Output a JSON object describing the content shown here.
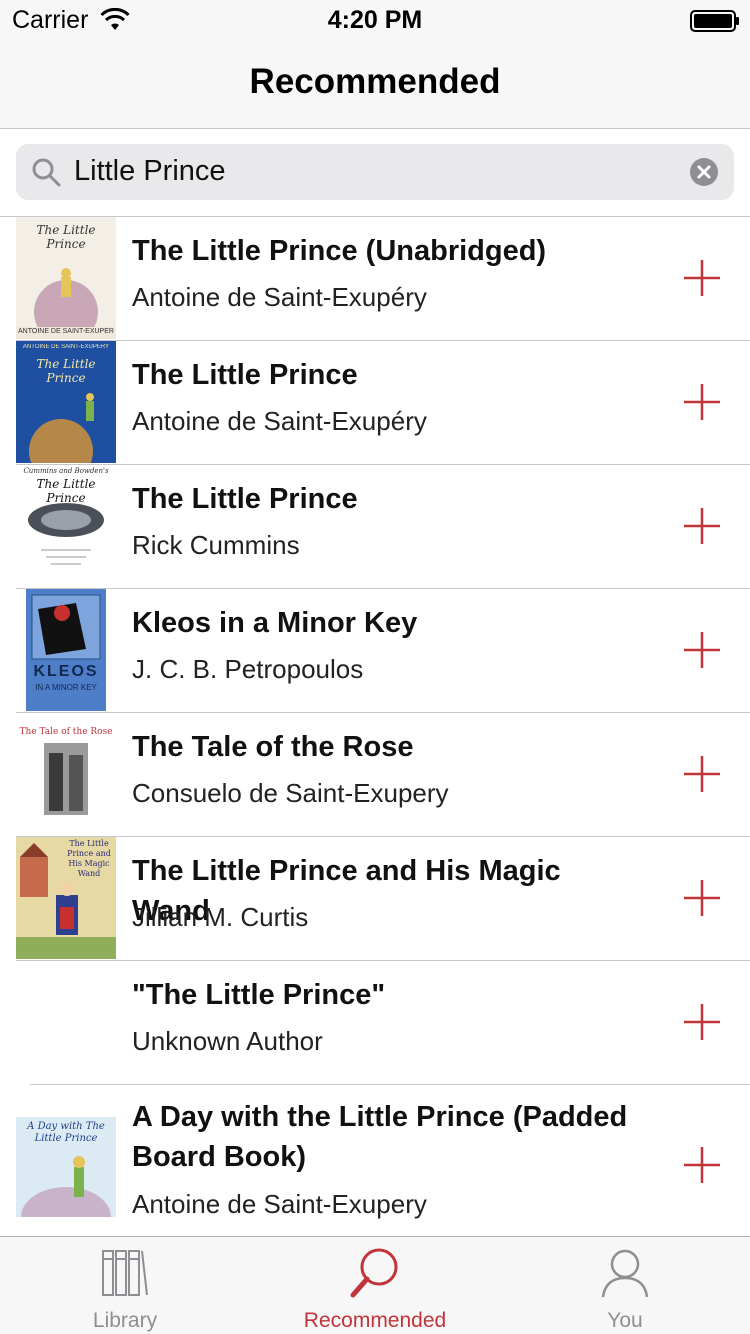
{
  "status_bar": {
    "carrier": "Carrier",
    "time": "4:20 PM"
  },
  "nav": {
    "title": "Recommended"
  },
  "search": {
    "value": "Little Prince"
  },
  "colors": {
    "accent": "#c0343a",
    "inactive": "#8e8e93",
    "separator": "#c8c7cc"
  },
  "books": [
    {
      "title": "The Little Prince (Unabridged)",
      "author": "Antoine de Saint-Exupéry",
      "cover_text": "The Little Prince",
      "cover_footer": "ANTOINE DE SAINT-EXUPÉRY"
    },
    {
      "title": "The Little Prince",
      "author": "Antoine de Saint-Exupéry",
      "cover_text": "The Little Prince",
      "cover_header": "ANTOINE DE SAINT-EXUPÉRY"
    },
    {
      "title": "The Little Prince",
      "author": "Rick Cummins",
      "cover_text": "The Little Prince",
      "cover_header": "Cummins and Bowden's"
    },
    {
      "title": "Kleos in a Minor Key",
      "author": "J. C. B. Petropoulos",
      "cover_text": "KLEOS",
      "cover_sub": "IN A MINOR KEY"
    },
    {
      "title": "The Tale of the Rose",
      "author": "Consuelo de Saint-Exupery",
      "cover_text": "The Tale of the Rose"
    },
    {
      "title": "The Little Prince and His Magic Wand",
      "author": "Jillian M. Curtis",
      "cover_text": "The Little Prince and His Magic Wand"
    },
    {
      "title": "\"The Little Prince\"",
      "author": "Unknown Author"
    },
    {
      "title": "A Day with the Little Prince (Padded Board Book)",
      "author": "Antoine de Saint-Exupery",
      "cover_text": "A Day with The Little Prince"
    }
  ],
  "tabs": [
    {
      "label": "Library",
      "icon": "library-icon"
    },
    {
      "label": "Recommended",
      "icon": "recommended-search-icon",
      "active": true
    },
    {
      "label": "You",
      "icon": "person-icon"
    }
  ]
}
